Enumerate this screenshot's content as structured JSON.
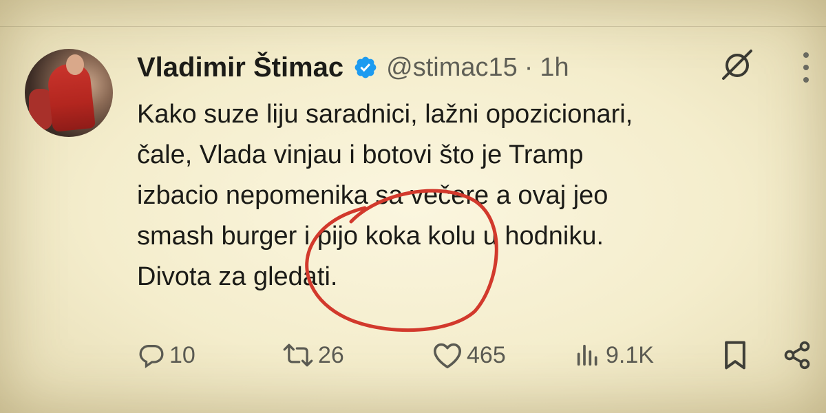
{
  "tweet": {
    "author_name": "Vladimir Štimac",
    "handle": "@stimac15",
    "separator": "·",
    "time": "1h",
    "lines": [
      "Kako suze liju saradnici, lažni opozicionari,",
      "čale, Vlada vinjau i botovi što je Tramp",
      "izbacio nepomenika sa večere a ovaj jeo",
      "smash burger i pijo koka kolu u hodniku.",
      "Divota za gledati."
    ]
  },
  "actions": {
    "reply_count": "10",
    "retweet_count": "26",
    "like_count": "465",
    "views_count": "9.1K"
  },
  "icons": {
    "verified": "verified-badge-icon",
    "grok": "grok-icon",
    "more": "more-vertical-icon",
    "reply": "reply-icon",
    "retweet": "retweet-icon",
    "like": "heart-icon",
    "views": "views-icon",
    "bookmark": "bookmark-icon",
    "share": "share-icon"
  },
  "colors": {
    "verified": "#1d9bf0",
    "annotation": "#d2392c",
    "text": "#1b1b17",
    "muted": "#5f5f56"
  }
}
